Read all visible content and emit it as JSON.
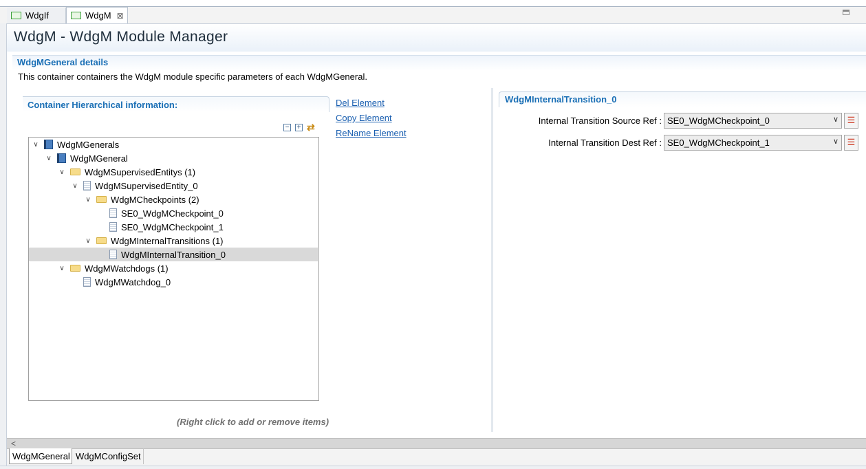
{
  "tabs": [
    {
      "label": "WdgIf",
      "active": false
    },
    {
      "label": "WdgM",
      "active": true,
      "close": "⊠"
    }
  ],
  "page_title": "WdgM - WdgM Module Manager",
  "section": {
    "title": "WdgMGeneral details",
    "description": "This container containers the WdgM module specific parameters of each WdgMGeneral."
  },
  "left": {
    "hier_title": "Container Hierarchical information:",
    "toolbar_icons": [
      "collapse-all-icon",
      "expand-all-icon",
      "link-sync-icon"
    ],
    "tree": [
      {
        "label": "WdgMGenerals",
        "icon": "book-icon",
        "level": 0,
        "twisty": "∨"
      },
      {
        "label": "WdgMGeneral",
        "icon": "book-icon",
        "level": 1,
        "twisty": "∨"
      },
      {
        "label": "WdgMSupervisedEntitys (1)",
        "icon": "folder-icon",
        "level": 2,
        "twisty": "∨"
      },
      {
        "label": "WdgMSupervisedEntity_0",
        "icon": "document-icon",
        "level": 3,
        "twisty": "∨"
      },
      {
        "label": "WdgMCheckpoints (2)",
        "icon": "folder-icon",
        "level": 4,
        "twisty": "∨"
      },
      {
        "label": "SE0_WdgMCheckpoint_0",
        "icon": "document-icon",
        "level": 5,
        "twisty": ""
      },
      {
        "label": "SE0_WdgMCheckpoint_1",
        "icon": "document-icon",
        "level": 5,
        "twisty": ""
      },
      {
        "label": "WdgMInternalTransitions (1)",
        "icon": "folder-icon",
        "level": 4,
        "twisty": "∨"
      },
      {
        "label": "WdgMInternalTransition_0",
        "icon": "document-icon",
        "level": 5,
        "twisty": "",
        "selected": true
      },
      {
        "label": "WdgMWatchdogs (1)",
        "icon": "folder-icon",
        "level": 2,
        "twisty": "∨"
      },
      {
        "label": "WdgMWatchdog_0",
        "icon": "document-icon",
        "level": 3,
        "twisty": ""
      }
    ],
    "hint": "(Right click to add or remove items)"
  },
  "actions": {
    "del": "Del Element",
    "copy": "Copy Element",
    "rename": "ReName Element"
  },
  "right": {
    "title": "WdgMInternalTransition_0",
    "fields": [
      {
        "label": "Internal Transition Source Ref :",
        "value": "SE0_WdgMCheckpoint_0"
      },
      {
        "label": "Internal Transition Dest Ref :",
        "value": "SE0_WdgMCheckpoint_1"
      }
    ]
  },
  "bottom_tabs": [
    {
      "label": "WdgMGeneral",
      "active": true
    },
    {
      "label": "WdgMConfigSet",
      "active": false
    }
  ],
  "scroll_left": "<"
}
